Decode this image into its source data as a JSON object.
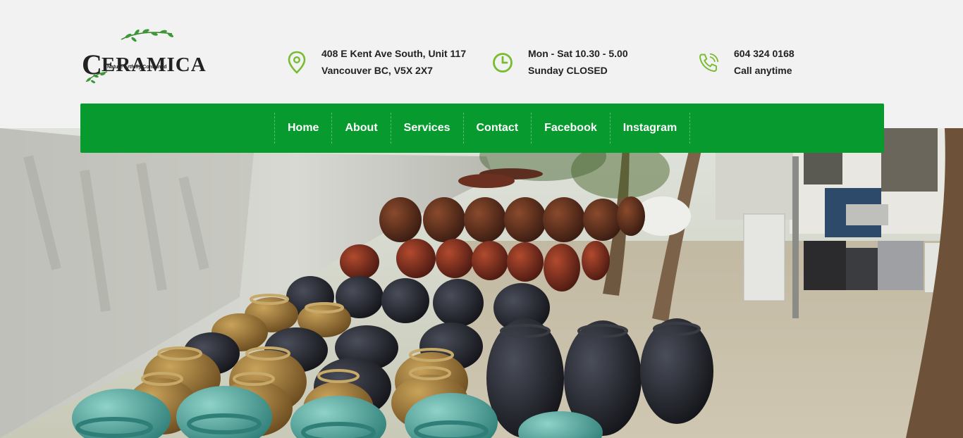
{
  "brand": {
    "name": "ERAMICA",
    "initial": "C",
    "tagline": "Nature Artfully Contained"
  },
  "contact": {
    "address": {
      "line1": "408 E Kent Ave South, Unit 117",
      "line2": "Vancouver BC, V5X 2X7",
      "icon": "map-pin-icon"
    },
    "hours": {
      "line1": "Mon - Sat 10.30 - 5.00",
      "line2": "Sunday CLOSED",
      "icon": "clock-icon"
    },
    "phone": {
      "line1": "604 324 0168",
      "line2": "Call anytime",
      "icon": "phone-icon"
    }
  },
  "nav": {
    "items": [
      {
        "label": "Home"
      },
      {
        "label": "About"
      },
      {
        "label": "Services"
      },
      {
        "label": "Contact"
      },
      {
        "label": "Facebook"
      },
      {
        "label": "Instagram"
      }
    ]
  },
  "colors": {
    "accent": "#79bc2f",
    "nav_bg": "#079a2f",
    "header_bg": "#f2f2f2"
  }
}
